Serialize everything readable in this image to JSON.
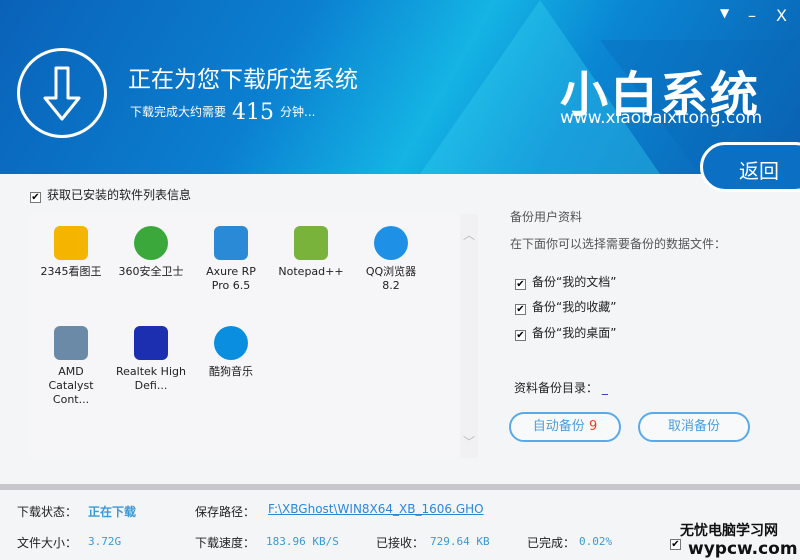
{
  "window": {
    "menu_icon": "dropdown-icon",
    "minimize": "–",
    "close": "X"
  },
  "header": {
    "title": "正在为您下载所选系统",
    "estimate_prefix": "下载完成大约需要",
    "estimate_minutes": "415",
    "estimate_suffix": "分钟...",
    "logo": "小白系统",
    "logo_url": "www.xiaobaixitong.com",
    "back": "返回"
  },
  "software": {
    "checkbox_label": "获取已安装的软件列表信息",
    "apps": [
      {
        "name": "2345看图王",
        "color": "#f5b400"
      },
      {
        "name": "360安全卫士",
        "color": "#3aa83a"
      },
      {
        "name": "Axure RP Pro 6.5",
        "color": "#2a8ad6"
      },
      {
        "name": "Notepad++",
        "color": "#7ab33c"
      },
      {
        "name": "QQ浏览器 8.2",
        "color": "#1e90e6"
      },
      {
        "name": "AMD Catalyst Cont...",
        "color": "#6a8aa8"
      },
      {
        "name": "Realtek High Defi...",
        "color": "#1c2fb0"
      },
      {
        "name": "酷狗音乐",
        "color": "#0a8ee0"
      }
    ]
  },
  "backup": {
    "heading": "备份用户资料",
    "desc": "在下面你可以选择需要备份的数据文件：",
    "options": [
      "备份“我的文档”",
      "备份“我的收藏”",
      "备份“我的桌面”"
    ],
    "dir_label": "资料备份目录：",
    "dir_value": "_",
    "auto_label": "自动备份",
    "auto_count": "9",
    "cancel_label": "取消备份"
  },
  "status": {
    "state_label": "下载状态：",
    "state": "正在下载",
    "path_label": "保存路径：",
    "path": "F:\\XBGhost\\WIN8X64_XB_1606.GHO",
    "size_label": "文件大小：",
    "size": "3.72G",
    "speed_label": "下载速度：",
    "speed": "183.96 KB/S",
    "received_label": "已接收：",
    "received": "729.64 KB",
    "done_label": "已完成：",
    "done": "0.02%"
  },
  "watermark": {
    "line1": "无忧电脑学习网",
    "line2": "wypcw.com"
  }
}
